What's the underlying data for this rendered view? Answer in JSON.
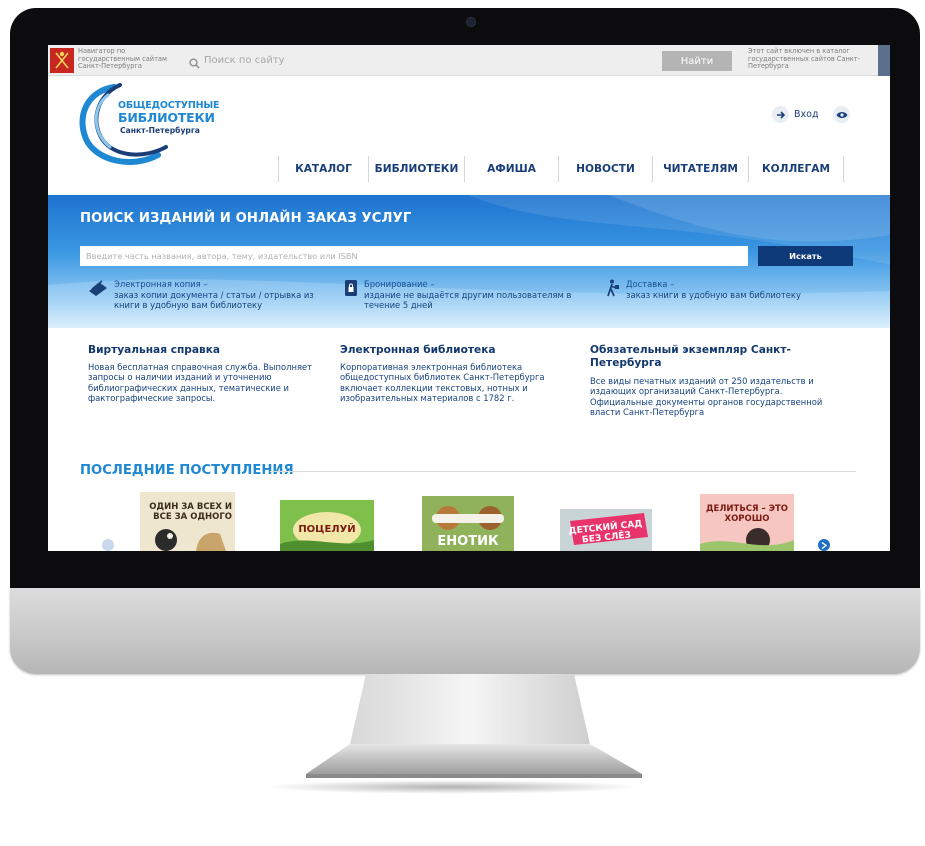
{
  "topbar": {
    "gov_text": "Навигатор по государственным сайтам Санкт-Петербурга",
    "search_placeholder": "Поиск по сайту",
    "find_button": "Найти",
    "catalog_note": "Этот сайт включен в каталог государственных сайтов Санкт-Петербурга"
  },
  "logo": {
    "line1": "ОБЩЕДОСТУПНЫЕ",
    "line2": "БИБЛИОТЕКИ",
    "line3": "Санкт-Петербурга"
  },
  "header": {
    "login_label": "Вход"
  },
  "nav": {
    "items": [
      {
        "label": "КАТАЛОГ"
      },
      {
        "label": "БИБЛИОТЕКИ"
      },
      {
        "label": "АФИША"
      },
      {
        "label": "НОВОСТИ"
      },
      {
        "label": "ЧИТАТЕЛЯМ"
      },
      {
        "label": "КОЛЛЕГАМ"
      }
    ]
  },
  "hero": {
    "title": "ПОИСК ИЗДАНИЙ И ОНЛАЙН ЗАКАЗ УСЛУГ",
    "search_placeholder": "Введите часть названия, автора, тему, издательство или ISBN",
    "search_button": "Искать",
    "services": [
      {
        "title": "Электронная копия –",
        "desc": "заказ копии документа / статьи / отрывка из книги в удобную вам библиотеку"
      },
      {
        "title": "Бронирование –",
        "desc": "издание не выдаётся другим пользователям в течение 5 дней"
      },
      {
        "title": "Доставка –",
        "desc": "заказ книги в удобную вам библиотеку"
      }
    ]
  },
  "info_columns": [
    {
      "title": "Виртуальная справка",
      "text": "Новая бесплатная справочная служба. Выполняет запросы о наличии изданий и уточнению библиографических данных, тематические и фактографические запросы."
    },
    {
      "title": "Электронная библиотека",
      "text": "Корпоративная электронная библиотека общедоступных библиотек Санкт-Петербурга включает коллекции текстовых, нотных и изобразительных материалов с 1782 г."
    },
    {
      "title": "Обязательный экземпляр Санкт-Петербурга",
      "text": "Все виды печатных изданий от 250 издательств и издающих организаций Санкт-Петербурга. Официальные документы органов государственной власти Санкт-Петербурга"
    }
  ],
  "new_arrivals": {
    "title": "ПОСЛЕДНИЕ ПОСТУПЛЕНИЯ",
    "books": [
      {
        "cover_text": "ОДИН ЗА ВСЕХ И ВСЕ ЗА ОДНОГО"
      },
      {
        "cover_text": "ПОЦЕЛУЙ"
      },
      {
        "cover_text": "ЕНОТИК"
      },
      {
        "cover_text": "ДЕТСКИЙ САД БЕЗ СЛЁЗ"
      },
      {
        "cover_text": "ДЕЛИТЬСЯ – ЭТО ХОРОШО"
      }
    ]
  },
  "colors": {
    "brand_blue": "#1f88d2",
    "navy": "#1a3e78",
    "hero_top": "#1e73cf",
    "hero_button": "#0f3a7a",
    "gov_red": "#c7271f"
  }
}
